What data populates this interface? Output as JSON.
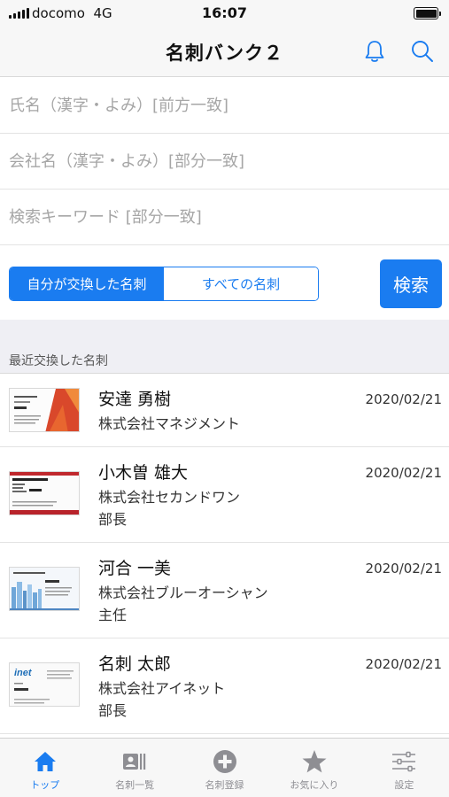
{
  "status_bar": {
    "carrier": "docomo",
    "network": "4G",
    "time": "16:07"
  },
  "nav": {
    "title": "名刺バンク２",
    "bell_icon": "bell-icon",
    "search_icon": "search-icon"
  },
  "search_form": {
    "name_placeholder": "氏名（漢字・よみ）[前方一致]",
    "company_placeholder": "会社名（漢字・よみ）[部分一致]",
    "keyword_placeholder": "検索キーワード [部分一致]",
    "segment_mine": "自分が交換した名刺",
    "segment_all": "すべての名刺",
    "selected_segment": "自分が交換した名刺",
    "search_button": "検索"
  },
  "section": {
    "title": "最近交換した名刺"
  },
  "cards": [
    {
      "name": "安達 勇樹",
      "company": "株式会社マネジメント",
      "title": "",
      "date": "2020/02/21"
    },
    {
      "name": "小木曽 雄大",
      "company": "株式会社セカンドワン",
      "title": "部長",
      "date": "2020/02/21"
    },
    {
      "name": "河合 一美",
      "company": "株式会社ブルーオーシャン",
      "title": "主任",
      "date": "2020/02/21"
    },
    {
      "name": "名刺 太郎",
      "company": "株式会社アイネット",
      "title": "部長",
      "date": "2020/02/21"
    }
  ],
  "tab_bar": {
    "tabs": [
      {
        "label": "トップ",
        "icon": "home-icon",
        "active": true
      },
      {
        "label": "名刺一覧",
        "icon": "card-list-icon",
        "active": false
      },
      {
        "label": "名刺登録",
        "icon": "add-circle-icon",
        "active": false
      },
      {
        "label": "お気に入り",
        "icon": "star-icon",
        "active": false
      },
      {
        "label": "設定",
        "icon": "settings-sliders-icon",
        "active": false
      }
    ]
  },
  "colors": {
    "accent": "#1a7cf0",
    "inactive_tab": "#8e8e93",
    "section_bg": "#efeff4"
  }
}
